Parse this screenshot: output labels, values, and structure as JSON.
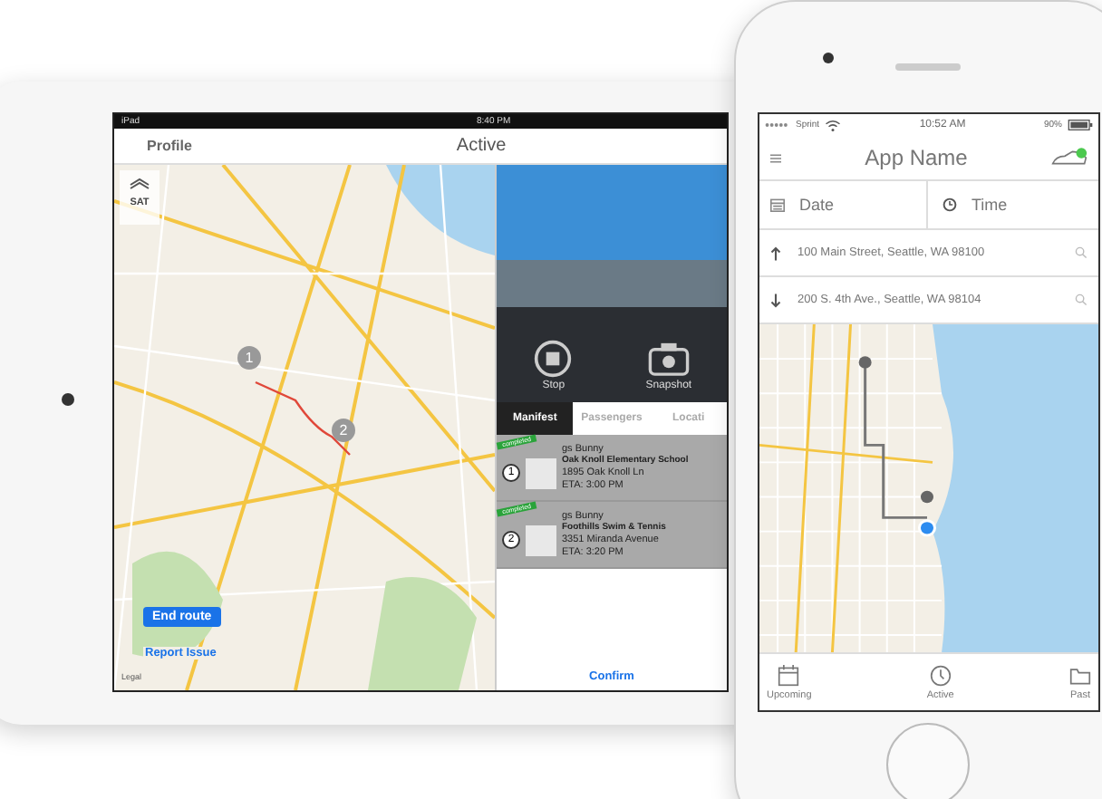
{
  "tablet": {
    "status_bar": {
      "device": "iPad",
      "time": "8:40 PM"
    },
    "nav": {
      "left": "Profile",
      "title": "Active"
    },
    "map": {
      "layer_toggle": "SAT",
      "end_route": "End route",
      "report_issue": "Report Issue",
      "legal": "Legal",
      "pins": [
        "1",
        "2"
      ]
    },
    "camera": {
      "controls": [
        {
          "kind": "stop",
          "label": "Stop"
        },
        {
          "kind": "snapshot",
          "label": "Snapshot"
        }
      ]
    },
    "tabs": [
      {
        "label": "Manifest",
        "selected": true
      },
      {
        "label": "Passengers",
        "selected": false
      },
      {
        "label": "Locati",
        "selected": false
      }
    ],
    "manifest": [
      {
        "number": "1",
        "ribbon": "completed",
        "name": "gs Bunny",
        "place": "Oak Knoll Elementary School",
        "address": "1895 Oak Knoll Ln",
        "eta": "ETA: 3:00 PM"
      },
      {
        "number": "2",
        "ribbon": "completed",
        "name": "gs Bunny",
        "place": "Foothills Swim & Tennis",
        "address": "3351 Miranda Avenue",
        "eta": "ETA: 3:20 PM"
      }
    ],
    "confirm": "Confirm"
  },
  "phone": {
    "status_bar": {
      "carrier": "Sprint",
      "time": "10:52 AM",
      "battery": "90%"
    },
    "nav": {
      "title": "App Name",
      "online": true
    },
    "when": [
      {
        "kind": "date",
        "label": "Date"
      },
      {
        "kind": "time",
        "label": "Time"
      }
    ],
    "addresses": [
      {
        "kind": "from",
        "value": "100 Main Street, Seattle, WA 98100"
      },
      {
        "kind": "to",
        "value": "200 S. 4th Ave., Seattle, WA 98104"
      }
    ],
    "tab_bar": [
      {
        "kind": "upcoming",
        "label": "Upcoming",
        "selected": false
      },
      {
        "kind": "active",
        "label": "Active",
        "selected": false
      },
      {
        "kind": "past",
        "label": "Past",
        "selected": false
      }
    ]
  }
}
